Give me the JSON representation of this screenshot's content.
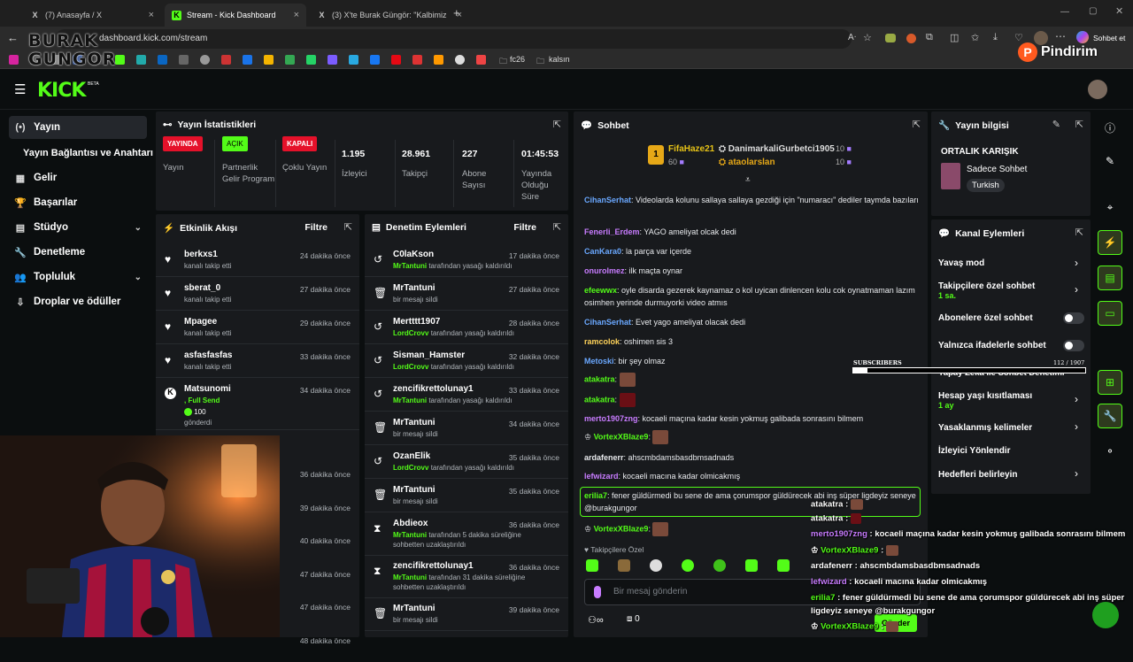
{
  "browser": {
    "tabs": [
      {
        "label": "(7) Anasayfa / X",
        "icon": "X"
      },
      {
        "label": "Stream - Kick Dashboard",
        "icon": "K"
      },
      {
        "label": "(3) X'te Burak Güngör: \"Kalbimizi b",
        "icon": "X"
      }
    ],
    "url": "dashboard.kick.com/stream",
    "profile_label": "Sohbet et",
    "bookmarks": [
      "fc26",
      "kalsın"
    ]
  },
  "watermark": {
    "brand": "BURAK GUNGOR",
    "pindirim": "Pindirim"
  },
  "kick": {
    "logo": "KICK",
    "beta": "BETA"
  },
  "sidebar": {
    "items": [
      {
        "label": "Yayın",
        "icon": "(•)"
      },
      {
        "label": "Yayın Bağlantısı ve Anahtarı",
        "icon": ""
      },
      {
        "label": "Gelir",
        "icon": "▦"
      },
      {
        "label": "Başarılar",
        "icon": "🏆"
      },
      {
        "label": "Stüdyo",
        "icon": "▤"
      },
      {
        "label": "Denetleme",
        "icon": "🔧"
      },
      {
        "label": "Topluluk",
        "icon": "👥"
      },
      {
        "label": "Droplar ve ödüller",
        "icon": "⇩"
      }
    ]
  },
  "stats": {
    "title": "Yayın İstatistikleri",
    "items": [
      {
        "badge": "YAYINDA",
        "label": "Yayın"
      },
      {
        "badge": "AÇIK",
        "label": "Partnerlik Gelir Programı"
      },
      {
        "badge": "KAPALI",
        "label": "Çoklu Yayın"
      },
      {
        "value": "1.195",
        "label": "İzleyici"
      },
      {
        "value": "28.961",
        "label": "Takipçi"
      },
      {
        "value": "227",
        "label": "Abone Sayısı"
      },
      {
        "value": "01:45:53",
        "label": "Yayında Olduğu Süre"
      }
    ]
  },
  "activity": {
    "title": "Etkinlik Akışı",
    "filter": "Filtre",
    "rows": [
      {
        "name": "berkxs1",
        "sub": "kanalı takip etti",
        "time": "24 dakika önce"
      },
      {
        "name": "sberat_0",
        "sub": "kanalı takip etti",
        "time": "27 dakika önce"
      },
      {
        "name": "Mpagee",
        "sub": "kanalı takip etti",
        "time": "29 dakika önce"
      },
      {
        "name": "asfasfasfas",
        "sub": "kanalı takip etti",
        "time": "33 dakika önce"
      },
      {
        "name": "Matsunomi",
        "sub": ", Full Send",
        "amount": "100",
        "extra": "gönderdi",
        "time": "34 dakika önce"
      }
    ],
    "extra_times": [
      "36 dakika önce",
      "39 dakika önce",
      "40 dakika önce",
      "47 dakika önce",
      "47 dakika önce",
      "48 dakika önce"
    ]
  },
  "moderation": {
    "title": "Denetim Eylemleri",
    "filter": "Filtre",
    "rows": [
      {
        "name": "C0laKson",
        "mod": "MrTantuni",
        "sub": "tarafından yasağı kaldırıldı",
        "time": "17 dakika önce",
        "icon": "↺"
      },
      {
        "name": "MrTantuni",
        "sub": "bir mesajı sildi",
        "time": "27 dakika önce",
        "icon": "🗑"
      },
      {
        "name": "Mertttt1907",
        "mod": "LordCrovv",
        "sub": "tarafından yasağı kaldırıldı",
        "time": "28 dakika önce",
        "icon": "↺"
      },
      {
        "name": "Sisman_Hamster",
        "mod": "LordCrovv",
        "sub": "tarafından yasağı kaldırıldı",
        "time": "32 dakika önce",
        "icon": "↺"
      },
      {
        "name": "zencifikrettolunay1",
        "mod": "MrTantuni",
        "sub": "tarafından yasağı kaldırıldı",
        "time": "33 dakika önce",
        "icon": "↺"
      },
      {
        "name": "MrTantuni",
        "sub": "bir mesajı sildi",
        "time": "34 dakika önce",
        "icon": "🗑"
      },
      {
        "name": "OzanElik",
        "mod": "LordCrovv",
        "sub": "tarafından yasağı kaldırıldı",
        "time": "35 dakika önce",
        "icon": "↺"
      },
      {
        "name": "MrTantuni",
        "sub": "bir mesajı sildi",
        "time": "35 dakika önce",
        "icon": "🗑"
      },
      {
        "name": "Abdieox",
        "mod": "MrTantuni",
        "sub": "tarafından 5 dakika süreliğine",
        "sub2": "sohbetten uzaklaştırıldı",
        "time": "36 dakika önce",
        "icon": "⧗"
      },
      {
        "name": "zencifikrettolunay1",
        "mod": "MrTantuni",
        "sub": "tarafından 31 dakika süreliğine",
        "sub2": "sohbetten uzaklaştırıldı",
        "time": "36 dakika önce",
        "icon": "⧗"
      },
      {
        "name": "MrTantuni",
        "sub": "bir mesajı sildi",
        "time": "39 dakika önce",
        "icon": "🗑"
      }
    ]
  },
  "chat": {
    "title": "Sohbet",
    "top": [
      {
        "rank": "1",
        "name": "FifaHaze21",
        "count": "60"
      },
      {
        "name": "DanimarkaliGurbetci1905",
        "count": "10"
      },
      {
        "name": "ataolarslan",
        "count": "10"
      }
    ],
    "messages": [
      {
        "user": "CihanSerhat",
        "color": "#6aa8ff",
        "text": ": Videolarda kolunu sallaya sallaya gezdiği için \"numaracı\" dediler taymda bazıları"
      },
      {
        "user": "Fenerli_Erdem",
        "color": "#c87cff",
        "text": ": YAGO ameliyat olcak dedi"
      },
      {
        "user": "CanKara0",
        "color": "#6aa8ff",
        "text": ": la parça var içerde"
      },
      {
        "user": "onurolmez",
        "color": "#c87cff",
        "text": ": ilk maçta oynar"
      },
      {
        "user": "efeewwx",
        "color": "#53fc18",
        "text": ": oyle disarda gezerek kaynamaz o kol uyican dinlencen kolu cok oynatmaman lazım osimhen yerinde durmuyorki video atmıs"
      },
      {
        "user": "CihanSerhat",
        "color": "#6aa8ff",
        "text": ": Evet yago ameliyat olacak dedi"
      },
      {
        "user": "ramcolok",
        "color": "#ffd35a",
        "text": ": oshimen sis 3"
      },
      {
        "user": "Metoski",
        "color": "#6aa8ff",
        "text": ": bir şey olmaz"
      },
      {
        "user": "atakatra",
        "color": "#53fc18",
        "text": ":"
      },
      {
        "user": "atakatra",
        "color": "#53fc18",
        "text": ":"
      },
      {
        "user": "merto1907zng",
        "color": "#c87cff",
        "text": ": kocaeli maçına kadar kesin yokmuş galibada sonrasını bilmem"
      },
      {
        "user": "VortexXBlaze9",
        "color": "#53fc18",
        "text": ":"
      },
      {
        "user": "ardafenerr",
        "color": "#e8eaed",
        "text": ": ahscmbdamsbasdbmsadnads"
      },
      {
        "user": "lefwizard",
        "color": "#c87cff",
        "text": ": kocaeli macına kadar olmicakmış"
      },
      {
        "user": "erilia7",
        "color": "#53fc18",
        "text": ": fener güldürmedi bu sene de ama çorumspor güldürecek abi inş süper ligdeyiz seneye @burakgungor"
      },
      {
        "user": "VortexXBlaze9",
        "color": "#53fc18",
        "text": ":"
      }
    ],
    "followers_only": "Takipçilere Özel",
    "placeholder": "Bir mesaj gönderin",
    "count_left": "0",
    "send": "Gönder"
  },
  "info": {
    "title": "Yayın bilgisi",
    "stream_title": "ORTALIK KARIŞIK",
    "category": "Sadece Sohbet",
    "tag": "Turkish"
  },
  "channel": {
    "title": "Kanal Eylemleri",
    "items": [
      {
        "label": "Yavaş mod",
        "kind": "chev"
      },
      {
        "label": "Takipçilere özel sohbet",
        "sub": "1 sa.",
        "kind": "chev"
      },
      {
        "label": "Abonelere özel sohbet",
        "kind": "toggle"
      },
      {
        "label": "Yalnızca ifadelerle sohbet",
        "kind": "toggle"
      },
      {
        "label": "Yapay Zeka ile Sohbet Denetimi",
        "kind": "chev"
      },
      {
        "label": "Hesap yaşı kısıtlaması",
        "sub": "1 ay",
        "kind": "chev"
      },
      {
        "label": "Yasaklanmış kelimeler",
        "kind": "chev"
      },
      {
        "label": "İzleyici Yönlendir",
        "kind": "none"
      },
      {
        "label": "Hedefleri belirleyin",
        "kind": "chev"
      }
    ]
  },
  "subs_overlay": {
    "label": "SUBSCRIBERS",
    "current": "112",
    "goal": "1907",
    "progress": 0.06
  },
  "overlay_chat": [
    {
      "user": "atakatra",
      "text": " :"
    },
    {
      "user": "atakatra",
      "text": " :"
    },
    {
      "user": "merto1907zng",
      "text": " : kocaeli maçına kadar kesin yokmuş galibada sonrasını bilmem"
    },
    {
      "user": "VortexXBlaze9",
      "text": " :"
    },
    {
      "user": "ardafenerr",
      "text": " : ahscmbdamsbasdbmsadnads"
    },
    {
      "user": "lefwizard",
      "text": " : kocaeli macına kadar olmicakmış"
    },
    {
      "user": "erilia7",
      "text": " : fener güldürmedi bu sene de ama çorumspor güldürecek abi inş süper"
    },
    {
      "user": "",
      "text": "ligdeyiz seneye @burakgungor"
    },
    {
      "user": "VortexXBlaze9",
      "text": " :"
    }
  ]
}
